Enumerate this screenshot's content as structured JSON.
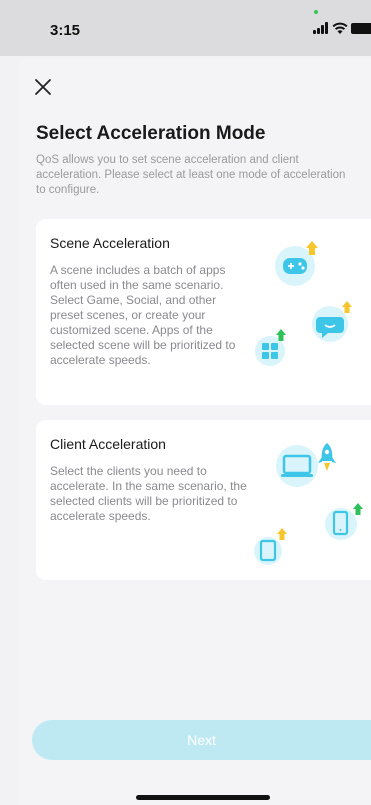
{
  "status": {
    "time": "3:15"
  },
  "header": {
    "title": "Select Acceleration Mode"
  },
  "intro": "QoS allows you to set scene acceleration and client acceleration. Please select at least one mode of acceleration to configure.",
  "cards": [
    {
      "title": "Scene Acceleration",
      "description": "A scene includes a batch of apps often used in the same scenario. Select Game, Social, and other preset scenes, or create your customized scene. Apps of the selected scene will be prioritized to accelerate speeds.",
      "icons": [
        "gamepad-icon",
        "chat-bubble-icon",
        "apps-grid-icon"
      ]
    },
    {
      "title": "Client Acceleration",
      "description": "Select the clients you need to accelerate. In the same scenario, the selected clients will be prioritized to accelerate speeds.",
      "icons": [
        "laptop-icon",
        "rocket-icon",
        "phone-icon",
        "tablet-icon"
      ]
    }
  ],
  "footer": {
    "next_label": "Next"
  },
  "colors": {
    "accent": "#3ec6e8",
    "button_disabled": "#bfe9f2",
    "arrow_yellow": "#f6c62c",
    "arrow_green": "#2fc25b"
  }
}
